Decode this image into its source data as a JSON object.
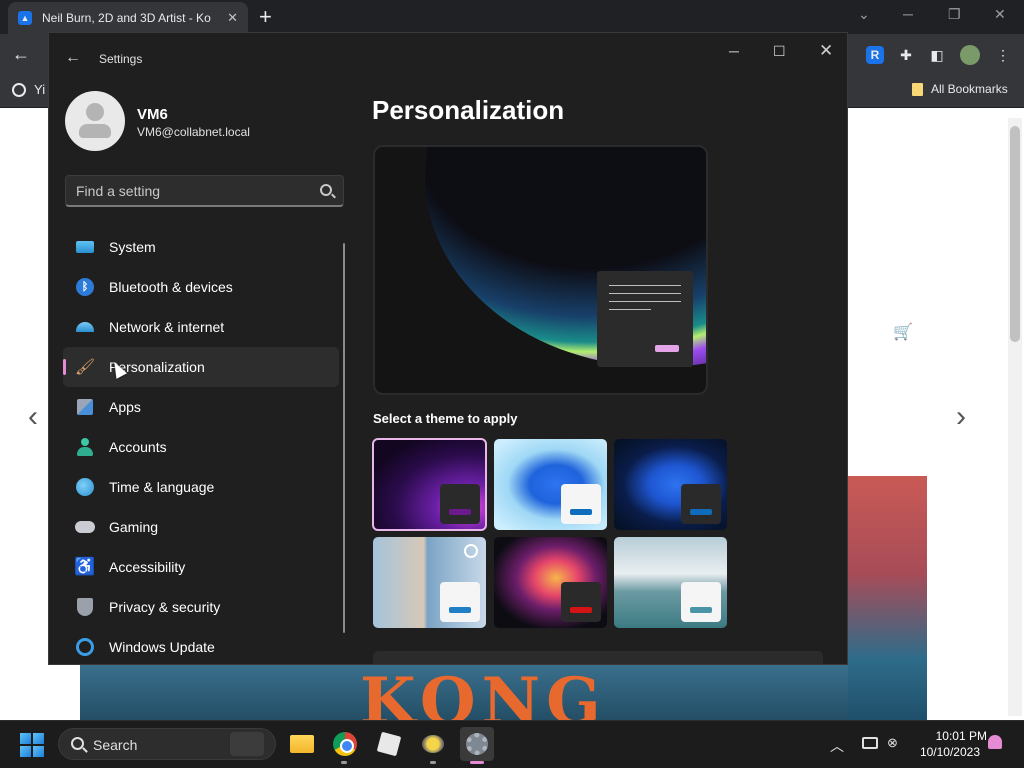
{
  "browser": {
    "tab_title": "Neil Burn, 2D and 3D Artist - Ko",
    "tab_close": "✕",
    "new_tab": "+",
    "bookmark_yi": "Yi",
    "all_bookmarks": "All Bookmarks",
    "banner_text": "KONG"
  },
  "window": {
    "title": "Settings",
    "back_glyph": "←",
    "minimize_glyph": "─",
    "maximize_glyph": "☐",
    "close_glyph": "✕"
  },
  "profile": {
    "name": "VM6",
    "email": "VM6@collabnet.local"
  },
  "search": {
    "placeholder": "Find a setting",
    "value": ""
  },
  "sidebar": {
    "items": [
      {
        "label": "System",
        "icon": "system-icon"
      },
      {
        "label": "Bluetooth & devices",
        "icon": "bluetooth-icon"
      },
      {
        "label": "Network & internet",
        "icon": "wifi-icon"
      },
      {
        "label": "Personalization",
        "icon": "brush-icon",
        "active": true
      },
      {
        "label": "Apps",
        "icon": "apps-icon"
      },
      {
        "label": "Accounts",
        "icon": "person-icon"
      },
      {
        "label": "Time & language",
        "icon": "globe-clock-icon"
      },
      {
        "label": "Gaming",
        "icon": "controller-icon"
      },
      {
        "label": "Accessibility",
        "icon": "accessibility-icon"
      },
      {
        "label": "Privacy & security",
        "icon": "shield-icon"
      },
      {
        "label": "Windows Update",
        "icon": "update-icon"
      }
    ]
  },
  "main": {
    "title": "Personalization",
    "theme_heading": "Select a theme to apply",
    "themes": [
      {
        "name": "windows-dark-glow",
        "selected": true,
        "accent": "#6a1a8a"
      },
      {
        "name": "windows-light",
        "selected": false,
        "accent": "#0f6cbd"
      },
      {
        "name": "windows-dark",
        "selected": false,
        "accent": "#0f6cbd"
      },
      {
        "name": "spotlight-collection",
        "selected": false,
        "accent": "#1f80c8"
      },
      {
        "name": "flow",
        "selected": false,
        "accent": "#d41414"
      },
      {
        "name": "sunrise-lake",
        "selected": false,
        "accent": "#4a93a8"
      }
    ]
  },
  "taskbar": {
    "search_label": "Search",
    "time": "10:01 PM",
    "date": "10/10/2023",
    "tray_chevron": "︿"
  },
  "colors": {
    "accent_pink": "#e58bd4",
    "window_bg": "#1f1f1f"
  }
}
